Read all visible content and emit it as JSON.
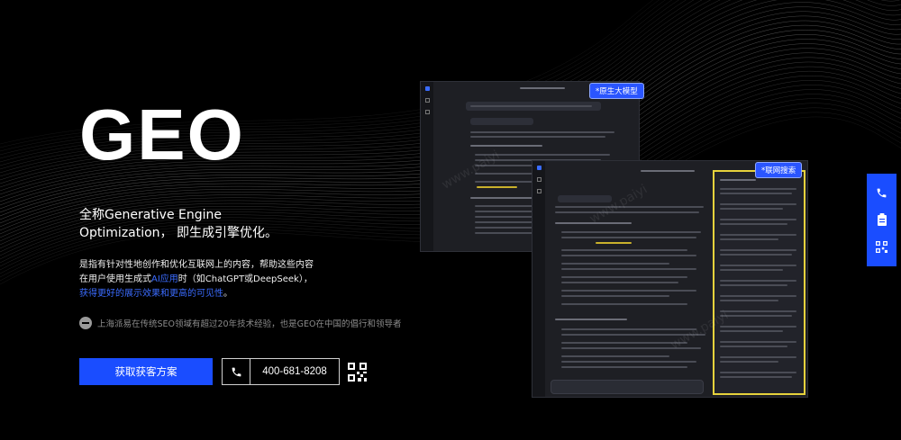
{
  "hero": {
    "title": "GEO",
    "subtitle": "全称Generative Engine Optimization， 即生成引擎优化。",
    "desc_part1": "是指有针对性地创作和优化互联网上的内容，帮助这些内容在用户使用生成式",
    "desc_highlight1": "AI应用",
    "desc_part2": "时（如ChatGPT或DeepSeek），",
    "desc_highlight2": "获得更好的展示效果和更高的可见性",
    "desc_part3": "。",
    "history": "上海派易在传统SEO领域有超过20年技术经验，也是GEO在中国的倡行和领导者"
  },
  "actions": {
    "cta_label": "获取获客方案",
    "phone_number": "400-681-8208"
  },
  "screens": {
    "tag_native": "*原生大模型",
    "tag_search": "*联网搜索"
  },
  "colors": {
    "accent": "#1a4dff",
    "highlight_border": "#e6d23c",
    "background": "#000000"
  },
  "icons": {
    "phone": "phone-icon",
    "qr": "qr-code-icon",
    "side": [
      "phone-icon",
      "clipboard-icon",
      "qr-code-icon"
    ]
  }
}
